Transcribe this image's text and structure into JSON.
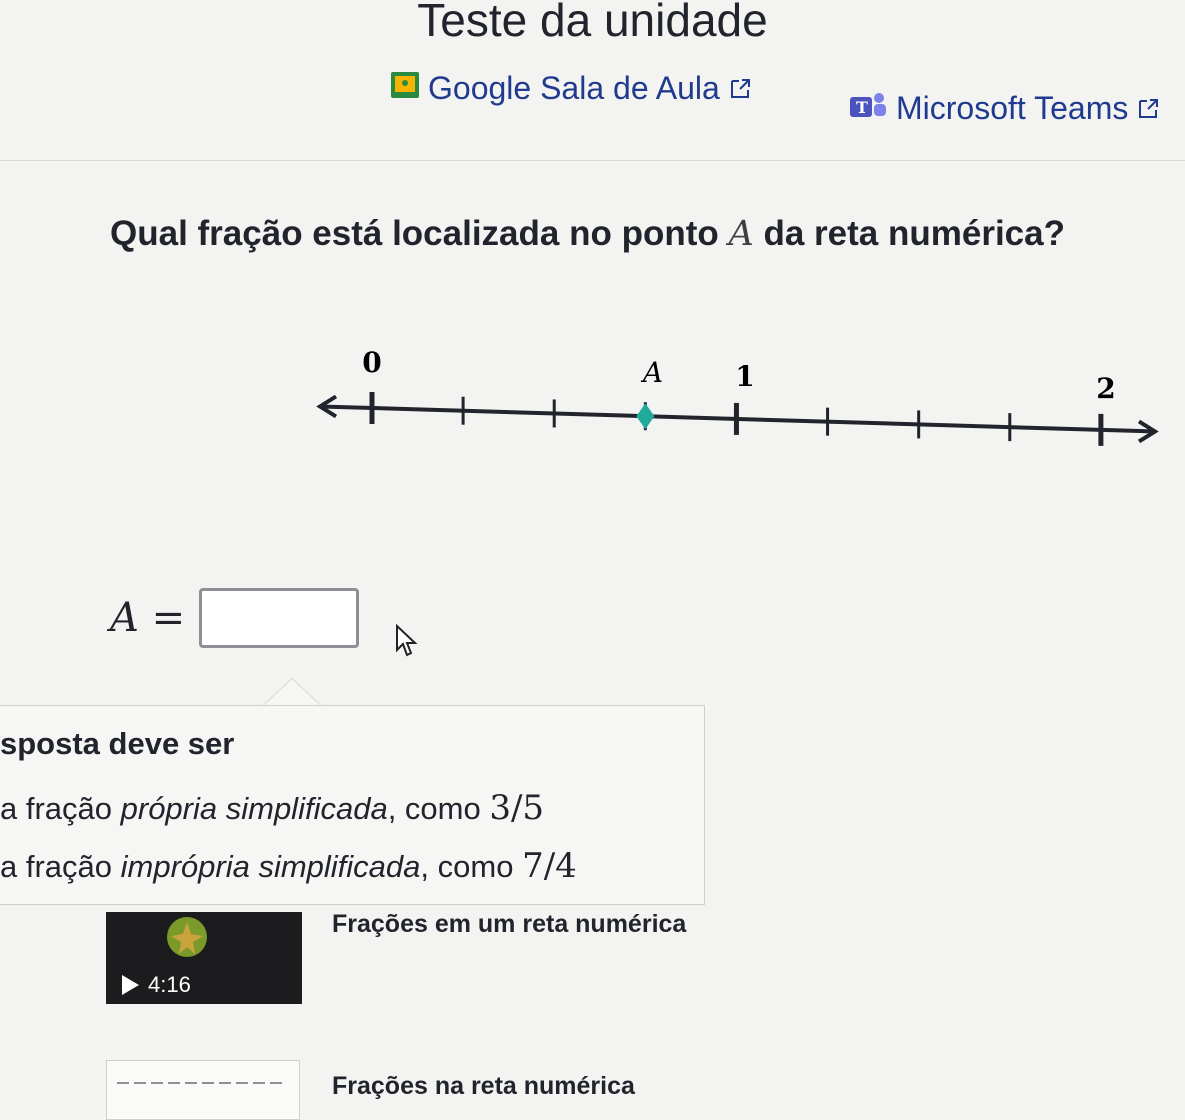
{
  "header": {
    "title": "Teste da unidade",
    "share_links": [
      {
        "label": "Google Sala de Aula",
        "icon": "google-classroom-icon"
      },
      {
        "label": "Microsoft Teams",
        "icon": "microsoft-teams-icon"
      }
    ]
  },
  "question": {
    "text_before": "Qual fração está localizada no ponto ",
    "variable": "A",
    "text_after": " da reta numérica?"
  },
  "number_line": {
    "labels": [
      "0",
      "A",
      "1",
      "2"
    ],
    "ticks_per_unit": 4,
    "point_color": "#1fab9c"
  },
  "answer": {
    "label": "A =",
    "value": ""
  },
  "hint": {
    "heading": "sposta deve ser",
    "items": [
      {
        "text": "a fração ",
        "style": "própria simplificada",
        "suffix": ", como ",
        "example": "3/5"
      },
      {
        "text": "a fração ",
        "style": "imprópria simplificada",
        "suffix": ", como ",
        "example": "7/4"
      }
    ]
  },
  "related": {
    "video": {
      "title": "Frações em um reta numérica",
      "duration": "4:16"
    },
    "article": {
      "title": "Frações na reta numérica"
    }
  },
  "colors": {
    "accent_teal": "#1fab9c",
    "link_blue": "#1f3a8f"
  }
}
